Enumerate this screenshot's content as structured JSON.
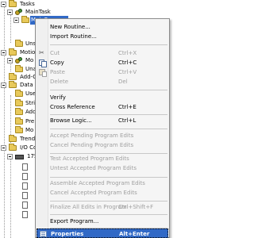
{
  "tree": {
    "rows": [
      {
        "label": "Tasks"
      },
      {
        "label": "MainTask"
      },
      {
        "label": "MainProgram"
      },
      {
        "label": "Uns"
      },
      {
        "label": "Motion"
      },
      {
        "label": "Mo"
      },
      {
        "label": "Una"
      },
      {
        "label": "Add-O"
      },
      {
        "label": "Data T"
      },
      {
        "label": "Use"
      },
      {
        "label": "Strin"
      },
      {
        "label": "Add"
      },
      {
        "label": "Pre"
      },
      {
        "label": "Mo"
      },
      {
        "label": "Trends"
      },
      {
        "label": "I/O Co"
      },
      {
        "label": "175"
      }
    ]
  },
  "menu": {
    "items": [
      {
        "label": "New Routine...",
        "shortcut": ""
      },
      {
        "label": "Import Routine...",
        "shortcut": ""
      },
      {
        "label": "Cut",
        "shortcut": "Ctrl+X"
      },
      {
        "label": "Copy",
        "shortcut": "Ctrl+C"
      },
      {
        "label": "Paste",
        "shortcut": "Ctrl+V"
      },
      {
        "label": "Delete",
        "shortcut": "Del"
      },
      {
        "label": "Verify",
        "shortcut": ""
      },
      {
        "label": "Cross Reference",
        "shortcut": "Ctrl+E"
      },
      {
        "label": "Browse Logic...",
        "shortcut": "Ctrl+L"
      },
      {
        "label": "Accept Pending Program Edits",
        "shortcut": ""
      },
      {
        "label": "Cancel Pending Program Edits",
        "shortcut": ""
      },
      {
        "label": "Test Accepted Program Edits",
        "shortcut": ""
      },
      {
        "label": "Untest Accepted Program Edits",
        "shortcut": ""
      },
      {
        "label": "Assemble Accepted Program Edits",
        "shortcut": ""
      },
      {
        "label": "Cancel Accepted Program Edits",
        "shortcut": ""
      },
      {
        "label": "Finalize All Edits in Program",
        "shortcut": "Ctrl+Shift+F"
      },
      {
        "label": "Export Program...",
        "shortcut": ""
      },
      {
        "label": "Properties",
        "shortcut": "Alt+Enter"
      }
    ]
  },
  "icons": {
    "cut": "✂"
  }
}
